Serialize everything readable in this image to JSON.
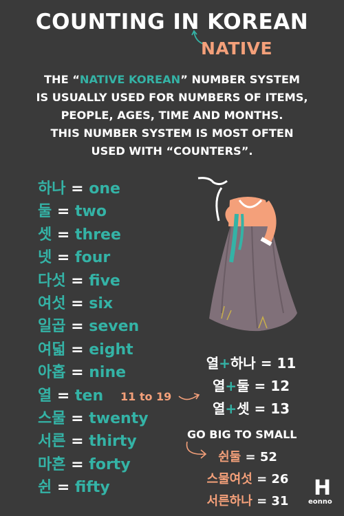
{
  "title": "COUNTING IN KOREAN",
  "subtitle_tag": "NATIVE",
  "intro": {
    "line1_pre": "THE “",
    "line1_highlight": "NATIVE KOREAN",
    "line1_post": "” NUMBER SYSTEM",
    "line2": "IS USUALLY USED FOR NUMBERS OF ITEMS,",
    "line3": "PEOPLE, AGES, TIME AND MONTHS.",
    "line4": "THIS NUMBER SYSTEM IS MOST OFTEN",
    "line5": "USED WITH “COUNTERS”."
  },
  "numbers": [
    {
      "ko": "하나",
      "en": "one"
    },
    {
      "ko": "둘",
      "en": "two"
    },
    {
      "ko": "셋",
      "en": "three"
    },
    {
      "ko": "넷",
      "en": "four"
    },
    {
      "ko": "다섯",
      "en": "five"
    },
    {
      "ko": "여섯",
      "en": "six"
    },
    {
      "ko": "일곱",
      "en": "seven"
    },
    {
      "ko": "여덟",
      "en": "eight"
    },
    {
      "ko": "아홉",
      "en": "nine"
    },
    {
      "ko": "열",
      "en": "ten"
    },
    {
      "ko": "스물",
      "en": "twenty"
    },
    {
      "ko": "서른",
      "en": "thirty"
    },
    {
      "ko": "마흔",
      "en": "forty"
    },
    {
      "ko": "쉰",
      "en": "fifty"
    }
  ],
  "equals": "=",
  "range_note": "11 to 19",
  "combos": [
    {
      "a": "열",
      "plus": "+",
      "b": "하나",
      "result": "= 11"
    },
    {
      "a": "열",
      "plus": "+",
      "b": "둘",
      "result": " = 12"
    },
    {
      "a": "열",
      "plus": "+",
      "b": "셋",
      "result": "= 13"
    }
  ],
  "go_big": "GO BIG TO SMALL",
  "big_small": [
    {
      "ko": "쉰둘",
      "result": "= 52"
    },
    {
      "ko": "스물여섯",
      "result": "= 26"
    },
    {
      "ko": "서른하나",
      "result": "= 31"
    }
  ],
  "logo": {
    "letter": "H",
    "text": "eonno"
  },
  "colors": {
    "background": "#3a3a3a",
    "teal": "#34b3a6",
    "peach": "#f4a07a",
    "white": "#ffffff"
  }
}
